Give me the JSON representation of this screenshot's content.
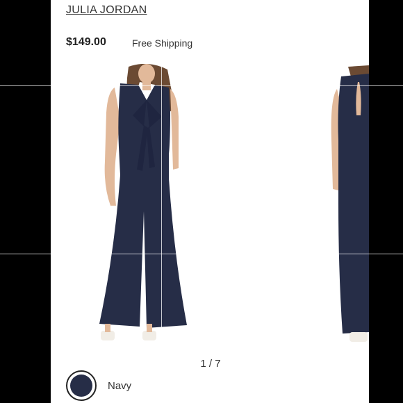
{
  "product": {
    "brand": "JULIA JORDAN",
    "price": "$149.00",
    "shipping": "Free Shipping"
  },
  "gallery": {
    "counter": "1 / 7",
    "garment_color": "#262d47"
  },
  "color_option": {
    "label": "Navy",
    "swatch_color": "#262d47"
  }
}
